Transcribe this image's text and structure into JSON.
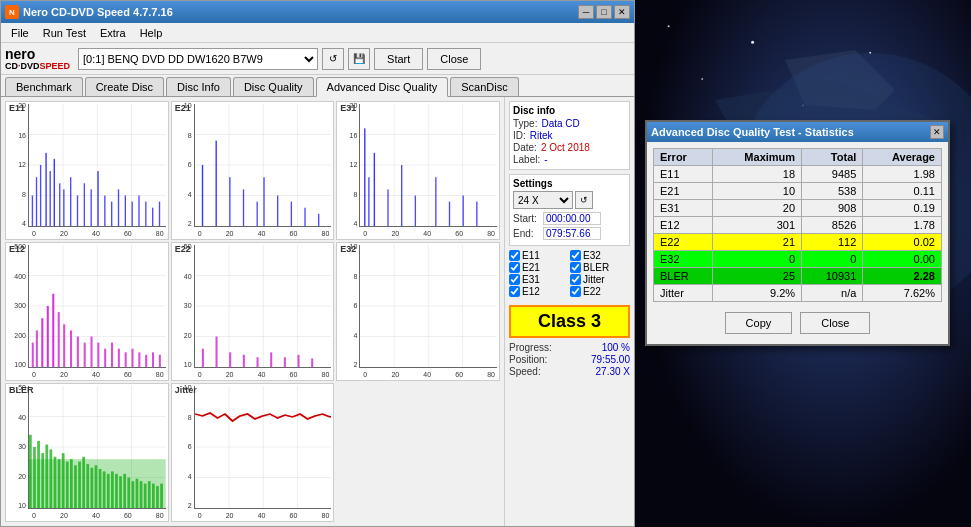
{
  "app": {
    "title": "Nero CD-DVD Speed 4.7.7.16",
    "icon": "●"
  },
  "title_bar": {
    "title": "Nero CD-DVD Speed 4.7.7.16",
    "minimize": "─",
    "maximize": "□",
    "close": "✕"
  },
  "menu": {
    "items": [
      "File",
      "Run Test",
      "Help",
      "Help"
    ]
  },
  "toolbar": {
    "drive_selector": "[0:1]  BENQ DVD DD DW1620 B7W9",
    "start_label": "Start",
    "close_label": "Close"
  },
  "tabs": [
    "Benchmark",
    "Create Disc",
    "Disc Info",
    "Disc Quality",
    "Advanced Disc Quality",
    "ScanDisc"
  ],
  "charts": [
    {
      "id": "E11",
      "label": "E11",
      "ymax": 20,
      "yticks": [
        "20",
        "16",
        "12",
        "8",
        "4"
      ],
      "color": "#0000ff",
      "type": "blue_bars"
    },
    {
      "id": "E21",
      "label": "E21",
      "ymax": 10,
      "yticks": [
        "10",
        "8",
        "6",
        "4",
        "2"
      ],
      "color": "#0000ff",
      "type": "blue_bars"
    },
    {
      "id": "E31",
      "label": "E31",
      "ymax": 20,
      "yticks": [
        "20",
        "16",
        "12",
        "8",
        "4"
      ],
      "color": "#0000ff",
      "type": "blue_bars"
    },
    {
      "id": "E12",
      "label": "E12",
      "ymax": 500,
      "yticks": [
        "500",
        "400",
        "300",
        "200",
        "100"
      ],
      "color": "#cc00cc",
      "type": "purple_bars"
    },
    {
      "id": "E22",
      "label": "E22",
      "ymax": 50,
      "yticks": [
        "50",
        "40",
        "30",
        "20",
        "10"
      ],
      "color": "#cc00cc",
      "type": "purple_bars"
    },
    {
      "id": "E32",
      "label": "E32",
      "ymax": 10,
      "yticks": [
        "10",
        "8",
        "6",
        "4",
        "2"
      ],
      "color": "#cc00cc",
      "type": "purple_bars"
    },
    {
      "id": "BLER",
      "label": "BLER",
      "ymax": 50,
      "yticks": [
        "50",
        "40",
        "30",
        "20",
        "10"
      ],
      "color": "#00aa00",
      "type": "green_bars"
    },
    {
      "id": "Jitter",
      "label": "Jitter",
      "ymax": 10,
      "yticks": [
        "10",
        "8",
        "6",
        "4",
        "2"
      ],
      "color": "#cc0000",
      "type": "red_line"
    }
  ],
  "disc_info": {
    "title": "Disc info",
    "type_label": "Type:",
    "type_value": "Data CD",
    "id_label": "ID:",
    "id_value": "Ritek",
    "date_label": "Date:",
    "date_value": "2 Oct 2018",
    "label_label": "Label:",
    "label_value": "-"
  },
  "settings": {
    "title": "Settings",
    "speed": "24 X",
    "start_label": "Start:",
    "start_value": "000:00.00",
    "end_label": "End:",
    "end_value": "079:57.66",
    "checkboxes": [
      {
        "id": "E11",
        "label": "E11",
        "checked": true
      },
      {
        "id": "E32",
        "label": "E32",
        "checked": true
      },
      {
        "id": "E21",
        "label": "E21",
        "checked": true
      },
      {
        "id": "BLER",
        "label": "BLER",
        "checked": true
      },
      {
        "id": "E31",
        "label": "E31",
        "checked": true
      },
      {
        "id": "Jitter",
        "label": "Jitter",
        "checked": true
      },
      {
        "id": "E12",
        "label": "E12",
        "checked": true
      },
      {
        "id": "E22",
        "label": "E22",
        "checked": true
      }
    ]
  },
  "class_badge": {
    "label": "Class 3",
    "bg_color": "#ffff00"
  },
  "progress": {
    "progress_label": "Progress:",
    "progress_value": "100 %",
    "position_label": "Position:",
    "position_value": "79:55.00",
    "speed_label": "Speed:",
    "speed_value": "27.30 X"
  },
  "stats_dialog": {
    "title": "Advanced Disc Quality Test - Statistics",
    "columns": [
      "Error",
      "Maximum",
      "Total",
      "Average"
    ],
    "rows": [
      {
        "error": "E11",
        "maximum": "18",
        "total": "9485",
        "average": "1.98",
        "highlight": "none"
      },
      {
        "error": "E21",
        "maximum": "10",
        "total": "538",
        "average": "0.11",
        "highlight": "none"
      },
      {
        "error": "E31",
        "maximum": "20",
        "total": "908",
        "average": "0.19",
        "highlight": "none"
      },
      {
        "error": "E12",
        "maximum": "301",
        "total": "8526",
        "average": "1.78",
        "highlight": "none"
      },
      {
        "error": "E22",
        "maximum": "21",
        "total": "112",
        "average": "0.02",
        "highlight": "yellow"
      },
      {
        "error": "E32",
        "maximum": "0",
        "total": "0",
        "average": "0.00",
        "highlight": "green"
      },
      {
        "error": "BLER",
        "maximum": "25",
        "total": "10931",
        "average": "2.28",
        "highlight": "green_bright"
      },
      {
        "error": "Jitter",
        "maximum": "9.2%",
        "total": "n/a",
        "average": "7.62%",
        "highlight": "none"
      }
    ],
    "copy_label": "Copy",
    "close_label": "Close"
  },
  "background": {
    "description": "Space/sci-fi imagery with spacecraft"
  }
}
